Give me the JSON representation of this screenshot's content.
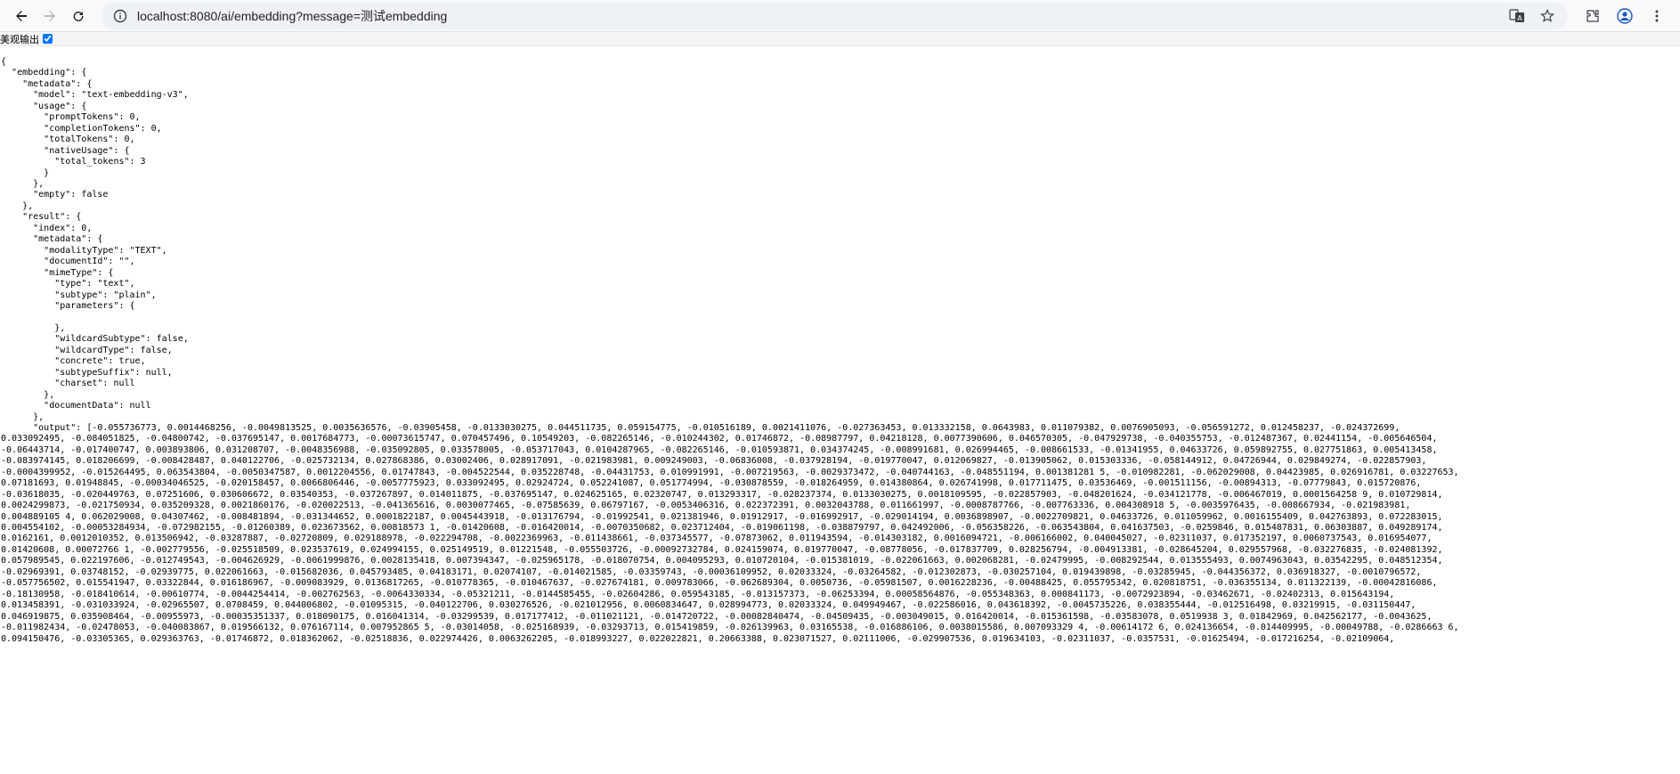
{
  "browser": {
    "url": "localhost:8080/ai/embedding?message=测试embedding",
    "icons": {
      "back": "back-arrow-icon",
      "forward": "forward-arrow-icon",
      "reload": "reload-icon",
      "site_info": "site-info-icon",
      "translate": "translate-icon",
      "bookmark": "star-icon",
      "extensions": "extensions-icon",
      "profile": "profile-icon"
    }
  },
  "pretty_print": {
    "label": "美观输出",
    "checked": true
  },
  "json_lines": [
    "{",
    "  \"embedding\": {",
    "    \"metadata\": {",
    "      \"model\": \"text-embedding-v3\",",
    "      \"usage\": {",
    "        \"promptTokens\": 0,",
    "        \"completionTokens\": 0,",
    "        \"totalTokens\": 0,",
    "        \"nativeUsage\": {",
    "          \"total_tokens\": 3",
    "        }",
    "      },",
    "      \"empty\": false",
    "    },",
    "    \"result\": {",
    "      \"index\": 0,",
    "      \"metadata\": {",
    "        \"modalityType\": \"TEXT\",",
    "        \"documentId\": \"\",",
    "        \"mimeType\": {",
    "          \"type\": \"text\",",
    "          \"subtype\": \"plain\",",
    "          \"parameters\": {",
    "",
    "          },",
    "          \"wildcardSubtype\": false,",
    "          \"wildcardType\": false,",
    "          \"concrete\": true,",
    "          \"subtypeSuffix\": null,",
    "          \"charset\": null",
    "        },",
    "        \"documentData\": null",
    "      },",
    "      \"output\": [-0.055736773, 0.0014468256, -0.0049813525, 0.0035636576, -0.03905458, -0.0133030275, 0.044511735, 0.059154775, -0.010516189, 0.0021411076, -0.027363453, 0.013332158, 0.0643983, 0.011079382, 0.0076905093, -0.056591272, 0.012458237, -0.024372699,",
    "0.033092495, -0.084051825, -0.04800742, -0.037695147, 0.0017684773, -0.00073615747, 0.070457496, 0.10549203, -0.082265146, -0.010244302, 0.01746872, -0.08987797, 0.04218128, 0.0077390606, 0.046570305, -0.047929738, -0.040355753, -0.012487367, 0.02441154, -0.005646504,",
    "-0.06443714, -0.017400747, 0.003893806, 0.031208707, -0.0048356988, -0.035092805, 0.033578005, -0.053717043, 0.0104287965, -0.082265146, -0.010593871, 0.034374245, -0.008991681, 0.026994465, -0.008661533, -0.01341955, 0.04633726, 0.059892755, 0.027751863, 0.005413458,",
    "-0.083974145, 0.018206699, -0.008428487, 0.040122706, -0.025732134, 0.027868386, 0.03002406, 0.028917091, -0.021983981, 0.009249003, -0.06836008, -0.037928194, -0.019770047, 0.012069827, -0.013905062, 0.015303336, -0.058144912, 0.04726944, 0.029849274, -0.022857903,",
    "-0.0004399952, -0.015264495, 0.063543804, -0.0050347587, 0.0012204556, 0.01747843, -0.004522544, 0.035228748, -0.04431753, 0.010991991, -0.007219563, -0.0029373472, -0.040744163, -0.048551194, 0.001381281 5, -0.010982281, -0.062029008, 0.04423985, 0.026916781, 0.03227653,",
    "0.07181693, 0.01948845, -0.00034046525, -0.020158457, 0.0066806446, -0.0057775923, 0.033092495, 0.02924724, 0.052241087, 0.051774994, -0.030878559, -0.018264959, 0.014380864, 0.026741998, 0.017711475, 0.03536469, -0.001511156, -0.00894313, -0.07779843, 0.015720876,",
    "-0.03618035, -0.020449763, 0.07251606, 0.030606672, 0.03540353, -0.037267897, 0.014011875, -0.037695147, 0.024625165, 0.02320747, 0.013293317, -0.028237374, 0.0133030275, 0.0018109595, -0.022857903, -0.048201624, -0.034121778, -0.006467019, 0.0001564258 9, 0.010729814,",
    "0.0024299873, -0.021750934, 0.035209328, 0.0021860176, -0.020022513, -0.041365616, 0.0030077465, -0.07585639, 0.06797167, -0.0053406316, 0.022372391, 0.0032043788, 0.011661997, -0.0008787766, -0.007763336, 0.004308918 5, -0.0035976435, -0.008667934, -0.021983981,",
    "0.004889105 4, 0.062029008, 0.04307462, -0.008481894, -0.031344652, 0.0001822187, 0.0045443918, -0.013176794, -0.01992541, 0.021381946, 0.01912917, -0.016992917, -0.029014194, 0.0036898907, -0.0022709821, 0.04633726, 0.011059962, 0.0016155409, 0.042763893, 0.072283015,",
    "0.004554102, -0.00053284934, -0.072982155, -0.01260389, 0.023673562, 0.00818573 1, -0.01420608, -0.016420014, -0.0070350682, 0.023712404, -0.019061198, -0.038879797, 0.042492006, -0.056358226, -0.063543804, 0.041637503, -0.0259846, 0.015487831, 0.06303887, 0.049289174,",
    "0.0162161, 0.0012010352, 0.013506942, -0.03287887, -0.02720809, 0.029188978, -0.022294708, -0.0022369963, -0.011438661, -0.037345577, -0.07873062, 0.011943594, -0.014303182, 0.0016094721, -0.006166002, 0.040045027, -0.02311037, 0.017352197, 0.0060737543, 0.016954077,",
    "0.01420608, 0.00072766 1, -0.002779556, -0.025518509, 0.023537619, 0.024994155, 0.025149519, 0.01221548, -0.055503726, -0.00092732784, 0.024159074, 0.019770047, -0.08778056, -0.017837709, 0.028256794, -0.004913381, -0.028645204, 0.029557968, -0.032276835, -0.024081392,",
    "0.057989545, 0.022197606, -0.012749543, -0.004626929, -0.0061999876, 0.0028135418, 0.007394347, -0.025965178, -0.018070754, 0.004095293, 0.010720104, -0.015381019, -0.022061663, 0.002068281, -0.02479995, -0.008292544, 0.013555493, 0.0074963043, 0.03542295, 0.048512354,",
    "-0.02969391, 0.03748152, -0.02939775, 0.022061663, -0.015682036, 0.045793485, 0.04183171, 0.02074107, -0.014021585, -0.03359743, -0.00036109952, 0.02033324, -0.03264582, -0.012302873, -0.030257104, 0.019439898, -0.03285945, -0.044356372, 0.036918327, -0.0010796572,",
    "-0.057756502, 0.015541947, 0.03322844, 0.016186967, -0.009083929, 0.0136817265, -0.010778365, -0.010467637, -0.027674181, 0.009783066, -0.062689304, 0.0050736, -0.05981507, 0.0016228236, -0.00488425, 0.055795342, 0.020818751, -0.036355134, 0.011322139, -0.00042816086,",
    "-0.18130958, -0.018410614, -0.00610774, -0.0044254414, -0.002762563, -0.0064330334, -0.05321211, -0.0144585455, -0.02604286, 0.059543185, -0.013157373, -0.06253394, 0.00058564876, -0.055348363, 0.000841173, -0.0072923894, -0.03462671, -0.02402313, 0.015643194,",
    "0.013458391, -0.031033924, -0.02965507, 0.0708459, 0.044006802, -0.01095315, -0.040122706, 0.030276526, -0.021012956, 0.0060834647, 0.028994773, 0.02033324, 0.049949467, -0.022586016, 0.043618392, -0.0045735226, 0.038355444, -0.012516498, 0.03219915, -0.031150447,",
    "0.046919875, 0.035908464, -0.00955973, -0.00035351337, 0.018090175, 0.016041314, -0.03299539, 0.017177412, -0.011021121, -0.014720722, -0.00082840474, -0.04509435, -0.003049015, 0.016420014, -0.015361598, -0.03583078, 0.0519938 3, 0.01842969, 0.042562177, -0.0043625,",
    "-0.011982434, -0.02478053, -0.040083867, 0.019566132, 0.076167114, 0.007952865 5, -0.03014058, -0.025168939, -0.03293713, 0.015419859, -0.026139963, 0.03165538, -0.016886106, 0.0038015586, 0.007093329 4, -0.00614172 6, 0.024136654, -0.014409995, -0.00049788, -0.0286663 6,",
    "0.094150476, -0.03305365, 0.029363763, -0.01746872, 0.018362062, -0.02518836, 0.022974426, 0.0063262205, -0.018993227, 0.022022821, 0.20663388, 0.023071527, 0.02111006, -0.029907536, 0.019634103, -0.02311037, -0.0357531, -0.01625494, -0.017216254, -0.02109064,"
  ]
}
